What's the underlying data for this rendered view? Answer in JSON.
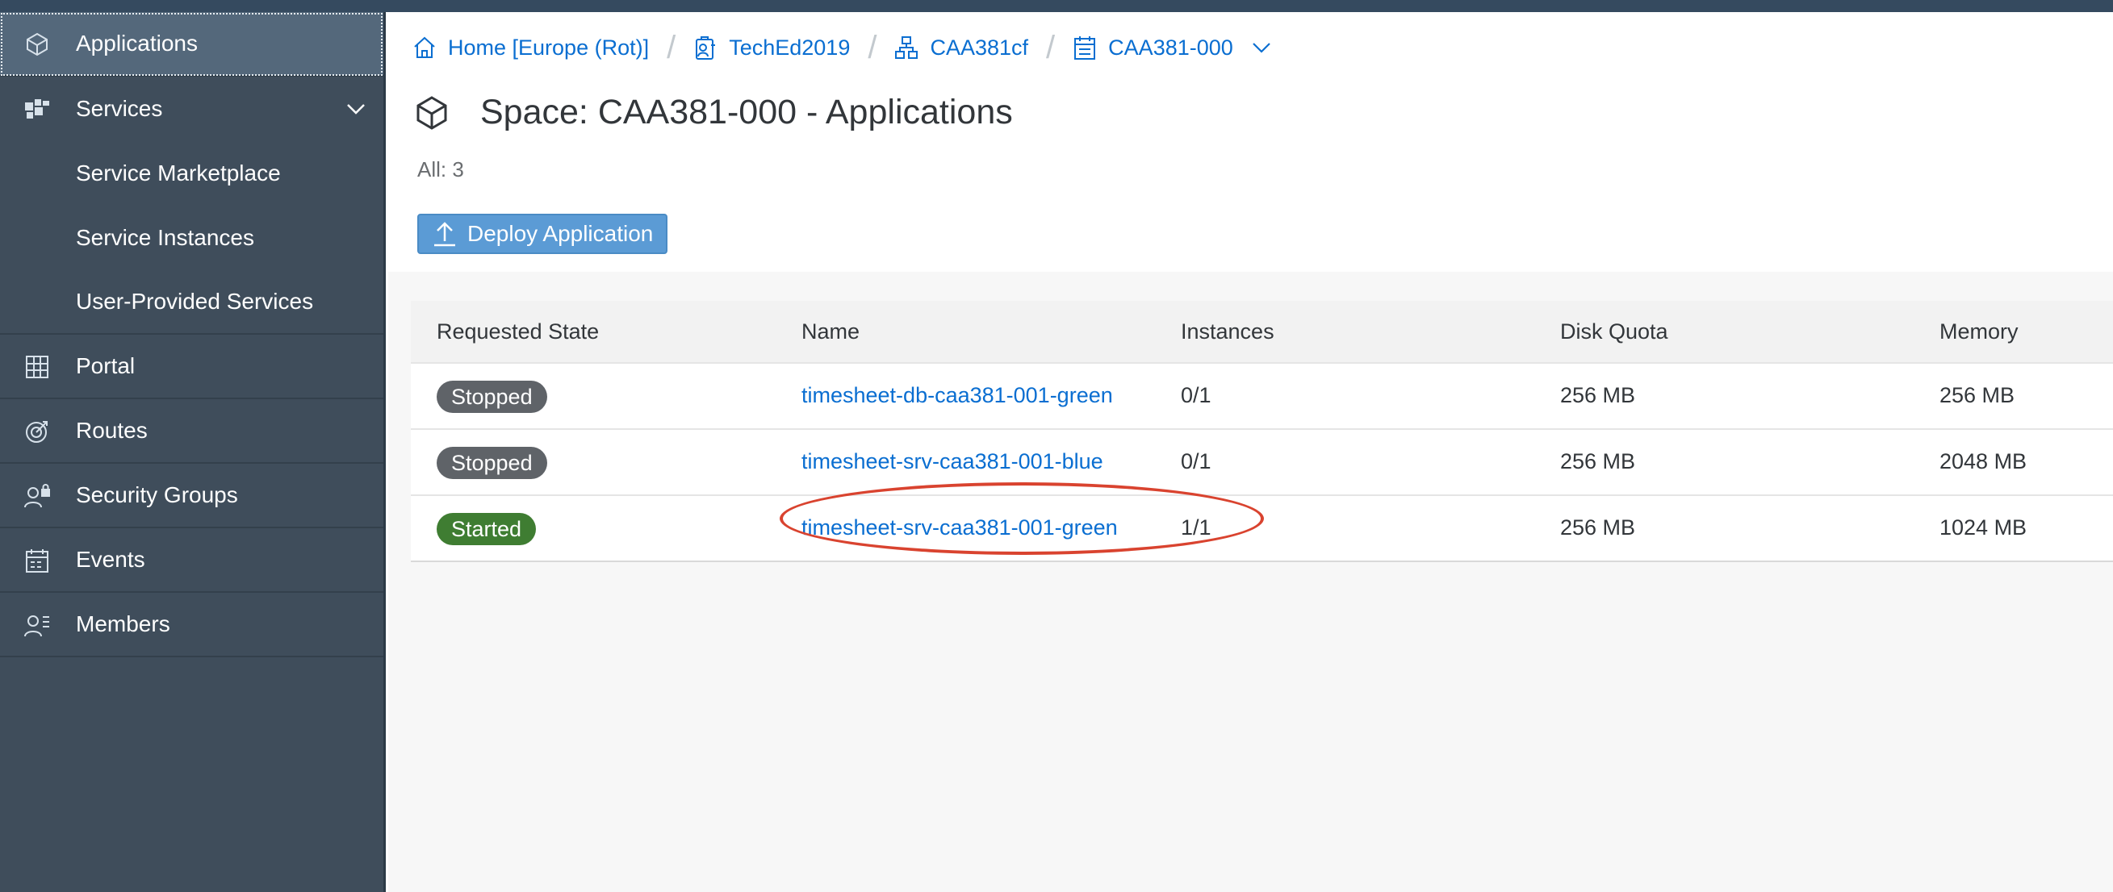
{
  "sidebar": {
    "items": [
      {
        "label": "Applications",
        "icon": "cube-icon",
        "selected": true
      },
      {
        "label": "Services",
        "icon": "puzzle-icon",
        "expanded": true
      },
      {
        "label": "Service Marketplace",
        "sub": true
      },
      {
        "label": "Service Instances",
        "sub": true
      },
      {
        "label": "User-Provided Services",
        "sub": true
      },
      {
        "label": "Portal",
        "icon": "grid-icon"
      },
      {
        "label": "Routes",
        "icon": "target-icon"
      },
      {
        "label": "Security Groups",
        "icon": "user-lock-icon"
      },
      {
        "label": "Events",
        "icon": "calendar-icon"
      },
      {
        "label": "Members",
        "icon": "user-list-icon"
      }
    ]
  },
  "breadcrumb": {
    "items": [
      {
        "label": "Home [Europe (Rot)]",
        "icon": "home-icon"
      },
      {
        "label": "TechEd2019",
        "icon": "global-account-icon"
      },
      {
        "label": "CAA381cf",
        "icon": "org-icon"
      },
      {
        "label": "CAA381-000",
        "icon": "space-icon"
      }
    ],
    "separator": "/"
  },
  "page": {
    "title": "Space: CAA381-000 - Applications",
    "count": "All: 3",
    "deploy_label": "Deploy Application"
  },
  "table": {
    "headers": [
      "Requested State",
      "Name",
      "Instances",
      "Disk Quota",
      "Memory"
    ],
    "rows": [
      {
        "state": "Stopped",
        "name": "timesheet-db-caa381-001-green",
        "instances": "0/1",
        "disk": "256 MB",
        "memory": "256 MB"
      },
      {
        "state": "Stopped",
        "name": "timesheet-srv-caa381-001-blue",
        "instances": "0/1",
        "disk": "256 MB",
        "memory": "2048 MB"
      },
      {
        "state": "Started",
        "name": "timesheet-srv-caa381-001-green",
        "instances": "1/1",
        "disk": "256 MB",
        "memory": "1024 MB"
      }
    ]
  },
  "colors": {
    "shell": "#354a5f",
    "sidebar": "#3f4d5b",
    "link": "#0a6ed1",
    "stopped": "#5f6368",
    "started": "#3f7d32",
    "annotation": "#d9432f"
  }
}
